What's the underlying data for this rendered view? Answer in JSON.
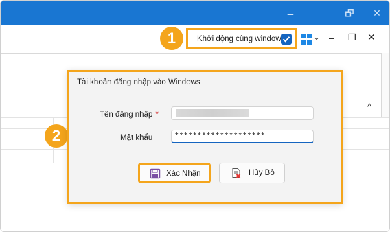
{
  "window": {
    "controls": [
      "🗕",
      "🗗",
      "✕"
    ]
  },
  "toolbar": {
    "startup_label": "Khởi động cùng windows",
    "startup_checked": true,
    "badge1": "1",
    "caret": "⌄",
    "minimize": "–",
    "restore": "❐",
    "close": "✕"
  },
  "ribbon": {
    "collapse": "^"
  },
  "badge2": "2",
  "dialog": {
    "title": "Tài khoản đăng nhập vào Windows",
    "username_label": "Tên đăng nhập",
    "required_mark": "*",
    "username_value": "",
    "password_label": "Mật khẩu",
    "password_value": "********************",
    "confirm_label": "Xác Nhận",
    "cancel_label": "Hủy Bỏ"
  },
  "colors": {
    "titlebar": "#1976d2",
    "highlight": "#f4a51c",
    "accent": "#1565c0"
  }
}
